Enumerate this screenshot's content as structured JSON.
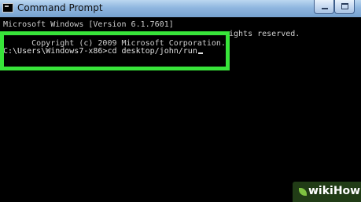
{
  "window": {
    "title": "Command Prompt",
    "app_icon": "cmd-icon",
    "controls": {
      "minimize_icon": "minimize-icon",
      "maximize_icon": "maximize-icon"
    }
  },
  "console": {
    "line1": "Microsoft Windows [Version 6.1.7601]",
    "line2_start": "Copyright (c) 2009 Microsoft Corporation.",
    "line2_end": "ights reserved.",
    "prompt": "C:\\Users\\Windows7-x86>",
    "command": "cd desktop/john/run"
  },
  "highlight": {
    "color": "#38e43a"
  },
  "watermark": {
    "text": "wikiHow",
    "icon": "leaf-icon"
  }
}
